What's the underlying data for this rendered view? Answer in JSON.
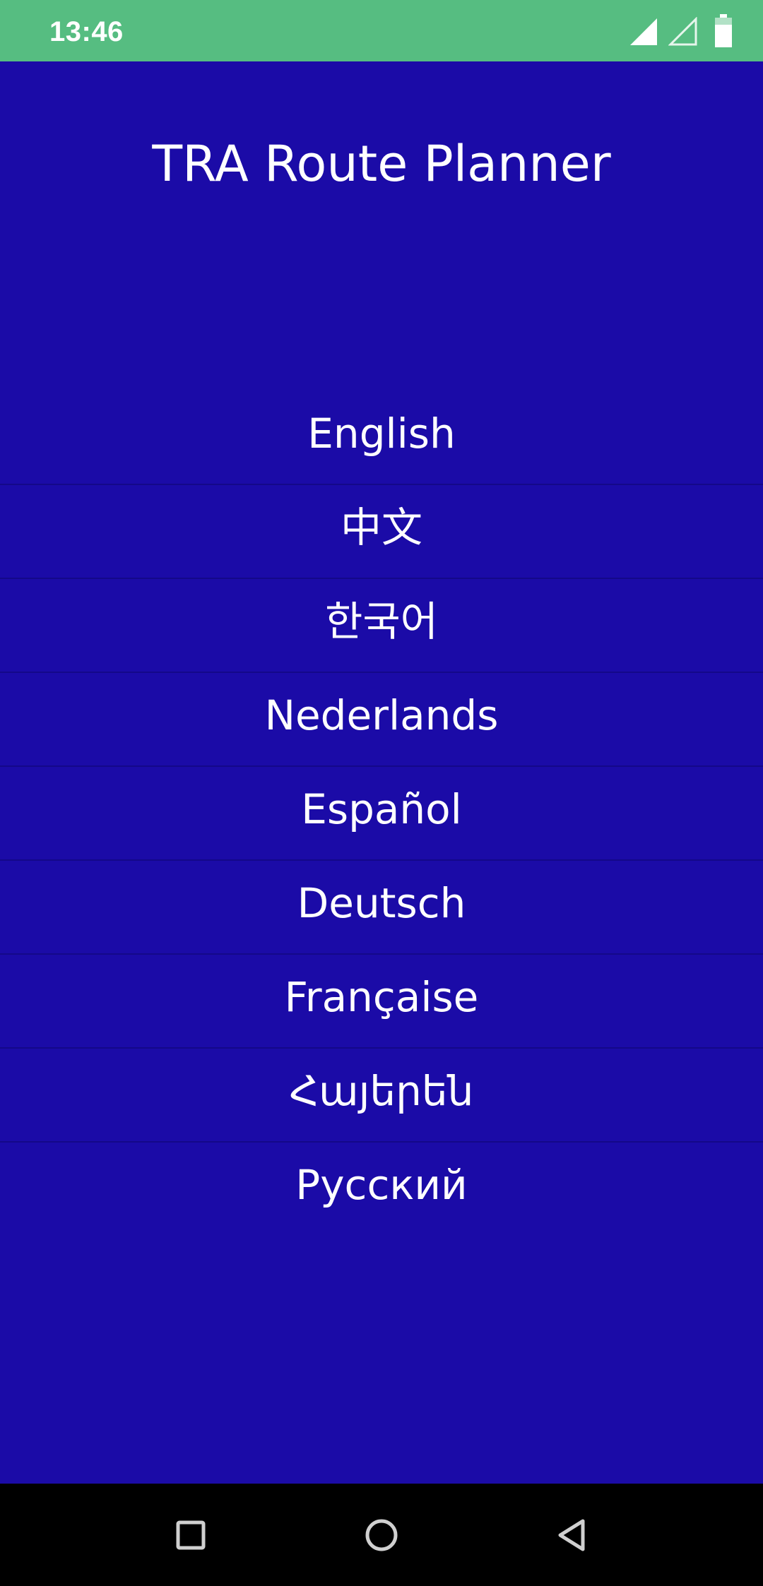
{
  "status_bar": {
    "time": "13:46",
    "icons": [
      "signal-icon",
      "signal-empty-icon",
      "battery-icon"
    ]
  },
  "app": {
    "title": "TRA Route Planner",
    "languages": [
      {
        "label": "English"
      },
      {
        "label": "中文"
      },
      {
        "label": "한국어"
      },
      {
        "label": "Nederlands"
      },
      {
        "label": "Español"
      },
      {
        "label": "Deutsch"
      },
      {
        "label": "Française"
      },
      {
        "label": "Հայերեն"
      },
      {
        "label": "Русский"
      }
    ]
  },
  "nav_bar": {
    "buttons": [
      "recents-icon",
      "home-icon",
      "back-icon"
    ]
  },
  "colors": {
    "status_bar": "#56bd81",
    "background": "#1b0ba7",
    "divider": "#140889",
    "text": "#ffffff",
    "nav_bar": "#000000"
  }
}
